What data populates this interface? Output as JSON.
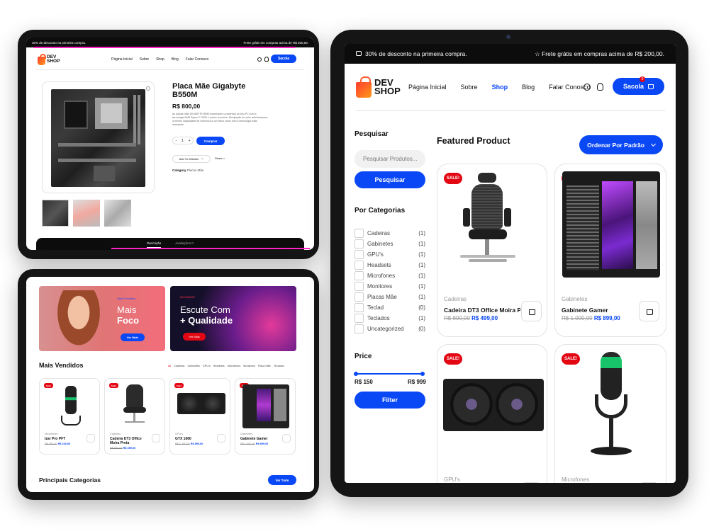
{
  "top_banner": {
    "left": "30% de desconto na primeira compra.",
    "right": "Frete grátis em compras acima de R$ 200,00."
  },
  "logo": {
    "line1": "DEV",
    "line2": "SHOP"
  },
  "nav": [
    "Página Inicial",
    "Sobre",
    "Shop",
    "Blog",
    "Falar Conosco"
  ],
  "nav_active": "Shop",
  "bag_label": "Sacola",
  "bag_count": "0",
  "product": {
    "title_line1": "Placa Mãe Gigabyte",
    "title_line2": "B550M",
    "price": "R$ 800,00",
    "description": "As placas mãe GIGABYTE B550 maximizam o potencial do seu PC com a tecnologia AMD Ryzen™ 3000 e outros recursos. Dissipação de calor adicional para a melhor capacidade de overclock a um baixo custo com a tecnologia mais avançada.",
    "qty": "1",
    "buy": "Comprar",
    "wishlist": "Add To Wishlist",
    "share": "Share",
    "category_label": "Category",
    "category_value": "Placas Mãe",
    "tabs": [
      "Descrição",
      "Avaliações"
    ],
    "reviews_count": "0"
  },
  "banners": [
    {
      "kicker": "Seja Produtivo",
      "line1": "Mais",
      "line2": "Foco",
      "cta": "Ver Mais"
    },
    {
      "kicker": "NOVIDADE",
      "line1": "Escute Com",
      "line2": "+ Qualidade",
      "cta": "Ver Mais"
    }
  ],
  "mais_vendidos": {
    "title": "Mais Vendidos",
    "filters": [
      "All",
      "Cadeiras",
      "Gabinetes",
      "GPU's",
      "Headsets",
      "Microfones",
      "Monitores",
      "Placa Mãe",
      "Teclados"
    ],
    "products": [
      {
        "category": "Microfones",
        "name_line1": "Izar Pro PFT",
        "name_line2": "",
        "old": "R$ 300,00",
        "price": "R$ 240,00",
        "badge": "Sale!"
      },
      {
        "category": "Cadeiras",
        "name_line1": "Cadeira DT3 Office",
        "name_line2": "Moira Preta",
        "old": "R$ 800,00",
        "price": "R$ 499,00",
        "badge": "Sale!"
      },
      {
        "category": "GPU's",
        "name_line1": "GTX 1660",
        "name_line2": "",
        "old": "R$ 1.200,00",
        "price": "R$ 899,00",
        "badge": "Sale!"
      },
      {
        "category": "Gabinetes",
        "name_line1": "Gabinete Gamer",
        "name_line2": "",
        "old": "R$ 1.000,00",
        "price": "R$ 899,00",
        "badge": "Sale!"
      }
    ]
  },
  "principais": {
    "title": "Principais Categorias",
    "cta": "Ver Tudo"
  },
  "shop": {
    "search_heading": "Pesquisar",
    "search_placeholder": "Pesquisar Produtos...",
    "search_button": "Pesquisar",
    "categories_heading": "Por Categorias",
    "categories": [
      {
        "name": "Cadeiras",
        "count": "(1)"
      },
      {
        "name": "Gabinetes",
        "count": "(1)"
      },
      {
        "name": "GPU's",
        "count": "(1)"
      },
      {
        "name": "Headsets",
        "count": "(1)"
      },
      {
        "name": "Microfones",
        "count": "(1)"
      },
      {
        "name": "Monitores",
        "count": "(1)"
      },
      {
        "name": "Placas Mãe",
        "count": "(1)"
      },
      {
        "name": "Teclad",
        "count": "(0)"
      },
      {
        "name": "Teclados",
        "count": "(1)"
      },
      {
        "name": "Uncategorized",
        "count": "(0)"
      }
    ],
    "price_heading": "Price",
    "price_min": "R$ 150",
    "price_max": "R$ 999",
    "filter_button": "Filter",
    "featured_title": "Featured Product",
    "sort_label": "Ordenar Por Padrão",
    "badge": "SALE!",
    "products": [
      {
        "category": "Cadeiras",
        "name": "Cadeira DT3 Office Moira Preta",
        "old": "R$ 800,00",
        "price": "R$ 499,00"
      },
      {
        "category": "Gabinetes",
        "name": "Gabinete Gamer",
        "old": "R$ 1.000,00",
        "price": "R$ 899,00"
      },
      {
        "category": "GPU's",
        "name": "",
        "old": "",
        "price": ""
      },
      {
        "category": "Microfones",
        "name": "",
        "old": "",
        "price": ""
      }
    ]
  },
  "colors": {
    "accent": "#0a48f6",
    "sale": "#e30613",
    "dark": "#0c0c0c"
  }
}
